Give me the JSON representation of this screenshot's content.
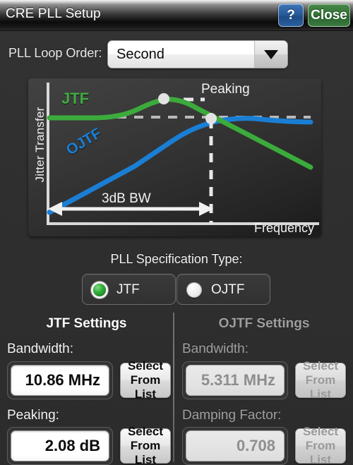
{
  "window": {
    "title": "CRE PLL Setup",
    "help_label": "?",
    "close_label": "Close"
  },
  "loop_order": {
    "label": "PLL Loop Order:",
    "value": "Second",
    "icon": "chevron-down-icon"
  },
  "chart_data": {
    "type": "line",
    "title": "",
    "xlabel": "Frequency",
    "ylabel": "Jitter Transfer",
    "grid": false,
    "legend_position": "inline",
    "annotations": [
      {
        "name": "peaking",
        "text": "Peaking"
      },
      {
        "name": "bandwidth",
        "text": "3dB BW"
      }
    ],
    "series": [
      {
        "name": "JTF",
        "color": "#3faa3f",
        "points": [
          [
            0,
            0.62
          ],
          [
            0.12,
            0.62
          ],
          [
            0.22,
            0.63
          ],
          [
            0.33,
            0.7
          ],
          [
            0.45,
            0.755
          ],
          [
            0.52,
            0.76
          ],
          [
            0.6,
            0.7
          ],
          [
            0.7,
            0.625
          ],
          [
            0.8,
            0.53
          ],
          [
            0.92,
            0.44
          ],
          [
            1.0,
            0.4
          ]
        ]
      },
      {
        "name": "OJTF",
        "color": "#1a7fd4",
        "points": [
          [
            0,
            0.12
          ],
          [
            0.18,
            0.24
          ],
          [
            0.36,
            0.38
          ],
          [
            0.52,
            0.52
          ],
          [
            0.62,
            0.62
          ],
          [
            0.72,
            0.7
          ],
          [
            0.8,
            0.725
          ],
          [
            0.88,
            0.7
          ],
          [
            0.94,
            0.655
          ],
          [
            1.0,
            0.645
          ]
        ]
      }
    ],
    "reference_level": 0.62,
    "markers": [
      {
        "name": "jtf-peak",
        "x": 0.45,
        "y": 0.755
      },
      {
        "name": "bw-point",
        "x": 0.63,
        "y": 0.62
      }
    ]
  },
  "spec_type": {
    "label": "PLL Specification Type:",
    "options": [
      {
        "id": "jtf",
        "label": "JTF",
        "selected": true
      },
      {
        "id": "ojtf",
        "label": "OJTF",
        "selected": false
      }
    ]
  },
  "jtf_settings": {
    "heading": "JTF Settings",
    "enabled": true,
    "bandwidth": {
      "label": "Bandwidth:",
      "value": "10.86 MHz",
      "button_line1": "Select",
      "button_line2": "From List"
    },
    "peaking": {
      "label": "Peaking:",
      "value": "2.08 dB",
      "button_line1": "Select",
      "button_line2": "From List"
    }
  },
  "ojtf_settings": {
    "heading": "OJTF Settings",
    "enabled": false,
    "bandwidth": {
      "label": "Bandwidth:",
      "value": "5.311 MHz",
      "button_line1": "Select",
      "button_line2": "From List"
    },
    "damping": {
      "label": "Damping Factor:",
      "value": "0.708",
      "button_line1": "Select",
      "button_line2": "From List"
    }
  },
  "colors": {
    "jtf": "#3faa3f",
    "ojtf": "#1a7fd4",
    "accent_green": "#2faa37",
    "help_blue": "#2a5f9e",
    "close_green": "#357a39",
    "panel_bg": "#2e2e2e"
  }
}
